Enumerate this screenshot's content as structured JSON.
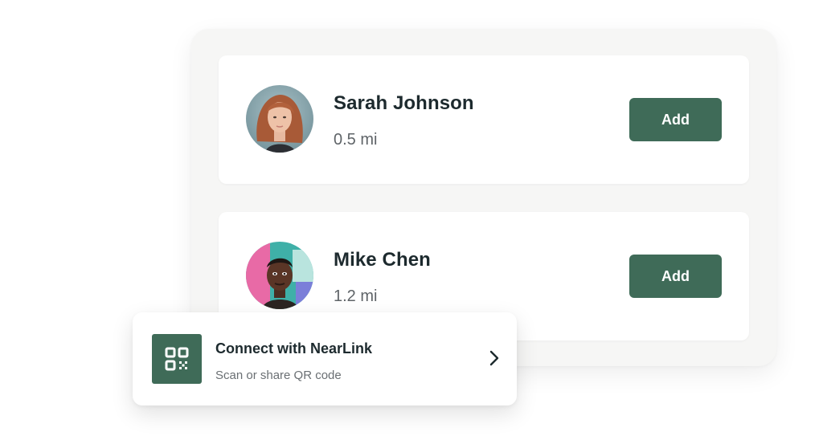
{
  "contacts": [
    {
      "name": "Sarah Johnson",
      "distance": "0.5 mi",
      "action_label": "Add"
    },
    {
      "name": "Mike Chen",
      "distance": "1.2 mi",
      "action_label": "Add"
    }
  ],
  "connect": {
    "title": "Connect with NearLink",
    "subtitle": "Scan or share QR code",
    "icon": "qr-code-icon",
    "chevron_icon": "chevron-right-icon"
  },
  "colors": {
    "accent": "#3f6b58",
    "panel_background": "#f6f6f5",
    "card_background": "#ffffff",
    "text_primary": "#1d2a2e",
    "text_secondary": "#5f6468"
  }
}
